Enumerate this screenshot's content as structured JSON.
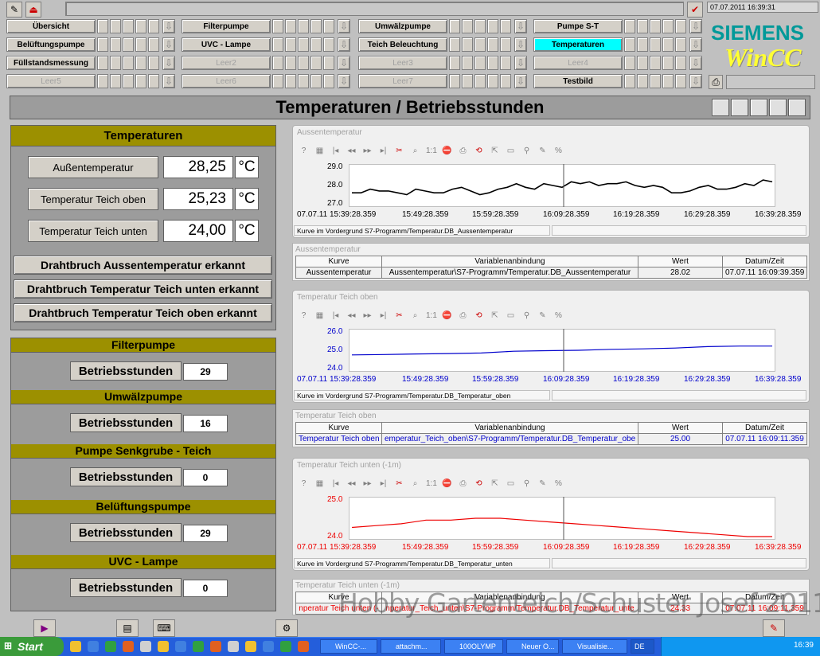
{
  "top": {
    "datetime": "07.07.2011 16:39:31"
  },
  "nav": [
    {
      "label": "Übersicht",
      "disabled": false,
      "active": false
    },
    {
      "label": "Filterpumpe",
      "disabled": false,
      "active": false
    },
    {
      "label": "Umwälzpumpe",
      "disabled": false,
      "active": false
    },
    {
      "label": "Pumpe S-T",
      "disabled": false,
      "active": false
    },
    {
      "label": "Belüftungspumpe",
      "disabled": false,
      "active": false
    },
    {
      "label": "UVC - Lampe",
      "disabled": false,
      "active": false
    },
    {
      "label": "Teich Beleuchtung",
      "disabled": false,
      "active": false
    },
    {
      "label": "Temperaturen",
      "disabled": false,
      "active": true
    },
    {
      "label": "Füllstandsmessung",
      "disabled": false,
      "active": false
    },
    {
      "label": "Leer2",
      "disabled": true,
      "active": false
    },
    {
      "label": "Leer3",
      "disabled": true,
      "active": false
    },
    {
      "label": "Leer4",
      "disabled": true,
      "active": false
    },
    {
      "label": "Leer5",
      "disabled": true,
      "active": false
    },
    {
      "label": "Leer6",
      "disabled": true,
      "active": false
    },
    {
      "label": "Leer7",
      "disabled": true,
      "active": false
    },
    {
      "label": "Testbild",
      "disabled": false,
      "active": false
    }
  ],
  "brand": {
    "siemens": "SIEMENS",
    "wincc": "WinCC"
  },
  "page_title": "Temperaturen / Betriebsstunden",
  "temps": {
    "header": "Temperaturen",
    "rows": [
      {
        "label": "Außentemperatur",
        "value": "28,25",
        "unit": "°C"
      },
      {
        "label": "Temperatur Teich oben",
        "value": "25,23",
        "unit": "°C"
      },
      {
        "label": "Temperatur Teich unten",
        "value": "24,00",
        "unit": "°C"
      }
    ],
    "alarms": [
      "Drahtbruch Aussentemperatur erkannt",
      "Drahtbruch Temperatur Teich unten erkannt",
      "Drahtbruch Temperatur Teich oben erkannt"
    ]
  },
  "hours": [
    {
      "name": "Filterpumpe",
      "label": "Betriebsstunden",
      "value": "29"
    },
    {
      "name": "Umwälzpumpe",
      "label": "Betriebsstunden",
      "value": "16"
    },
    {
      "name": "Pumpe Senkgrube - Teich",
      "label": "Betriebsstunden",
      "value": "0"
    },
    {
      "name": "Belüftungspumpe",
      "label": "Betriebsstunden",
      "value": "29"
    },
    {
      "name": "UVC - Lampe",
      "label": "Betriebsstunden",
      "value": "0"
    }
  ],
  "table_headers": {
    "kurve": "Kurve",
    "var": "Variablenanbindung",
    "wert": "Wert",
    "datum": "Datum/Zeit"
  },
  "charts": [
    {
      "title": "Aussentemperatur",
      "status": "Kurve im Vordergrund S7-Programm/Temperatur.DB_Aussentemperatur",
      "table_title": "Aussentemperatur",
      "row": {
        "kurve": "Aussentemperatur",
        "var": "Aussentemperatur\\S7-Programm/Temperatur.DB_Aussentemperatur",
        "wert": "28.02",
        "datum": "07.07.11 16:09:39.359"
      },
      "color": "#000000"
    },
    {
      "title": "Temperatur Teich oben",
      "status": "Kurve im Vordergrund S7-Programm/Temperatur.DB_Temperatur_oben",
      "table_title": "Temperatur Teich oben",
      "row": {
        "kurve": "Temperatur Teich oben",
        "var": "emperatur_Teich_oben\\S7-Programm/Temperatur.DB_Temperatur_obe",
        "wert": "25.00",
        "datum": "07.07.11 16:09:11.359"
      },
      "color": "#0000cc"
    },
    {
      "title": "Temperatur Teich unten (-1m)",
      "status": "Kurve im Vordergrund S7-Programm/Temperatur.DB_Temperatur_unten",
      "table_title": "Temperatur Teich unten (-1m)",
      "row": {
        "kurve": "nperatur Teich unten (-",
        "var": "nperatur_Teich_unten\\S7-Programm/Temperatur.DB_Temperatur_unte",
        "wert": "24.33",
        "datum": "07.07.11 16:09:11.359"
      },
      "color": "#ee0000"
    }
  ],
  "chart_data": [
    {
      "type": "line",
      "title": "Aussentemperatur",
      "x_ticks": [
        "07.07.11  15:39:28.359",
        "15:49:28.359",
        "15:59:28.359",
        "16:09:28.359",
        "16:19:28.359",
        "16:29:28.359",
        "16:39:28.359"
      ],
      "y_ticks": [
        "29.0",
        "28.0",
        "27.0"
      ],
      "ylim": [
        27.0,
        29.0
      ],
      "series": [
        {
          "values": [
            27.6,
            27.6,
            27.8,
            27.7,
            27.7,
            27.6,
            27.5,
            27.8,
            27.7,
            27.6,
            27.6,
            27.8,
            27.9,
            27.7,
            27.5,
            27.6,
            27.8,
            27.9,
            28.1,
            27.9,
            27.8,
            28.1,
            28.0,
            27.9,
            28.2,
            28.1,
            28.2,
            28.0,
            28.1,
            28.1,
            28.2,
            28.0,
            27.9,
            28.0,
            27.9,
            27.6,
            27.6,
            27.7,
            27.9,
            28.0,
            27.8,
            27.8,
            27.9,
            28.1,
            28.0,
            28.3,
            28.2
          ]
        }
      ]
    },
    {
      "type": "line",
      "title": "Temperatur Teich oben",
      "x_ticks": [
        "07.07.11  15:39:28.359",
        "15:49:28.359",
        "15:59:28.359",
        "16:09:28.359",
        "16:19:28.359",
        "16:29:28.359",
        "16:39:28.359"
      ],
      "y_ticks": [
        "26.0",
        "25.0",
        "24.0"
      ],
      "ylim": [
        24.0,
        26.0
      ],
      "series": [
        {
          "values": [
            24.75,
            24.77,
            24.8,
            24.82,
            24.85,
            24.95,
            24.98,
            25.0,
            25.05,
            25.08,
            25.12,
            25.2,
            25.23,
            25.23
          ]
        }
      ]
    },
    {
      "type": "line",
      "title": "Temperatur Teich unten (-1m)",
      "x_ticks": [
        "07.07.11  15:39:28.359",
        "15:49:28.359",
        "15:59:28.359",
        "16:09:28.359",
        "16:19:28.359",
        "16:29:28.359",
        "16:39:28.359"
      ],
      "y_ticks": [
        "25.0",
        "24.0"
      ],
      "ylim": [
        24.0,
        25.0
      ],
      "series": [
        {
          "values": [
            24.25,
            24.3,
            24.35,
            24.45,
            24.45,
            24.5,
            24.5,
            24.45,
            24.4,
            24.35,
            24.3,
            24.25,
            24.2,
            24.15,
            24.1,
            24.05,
            24.0,
            24.0
          ]
        }
      ]
    }
  ],
  "watermark": "Hobby Gartenteich/Schuster Josef 2011",
  "taskbar": {
    "start": "Start",
    "tasks": [
      "WinCC-...",
      "attachm...",
      "100OLYMP",
      "Neuer O...",
      "Visualisie...",
      "DE"
    ],
    "clock": "16:39"
  }
}
